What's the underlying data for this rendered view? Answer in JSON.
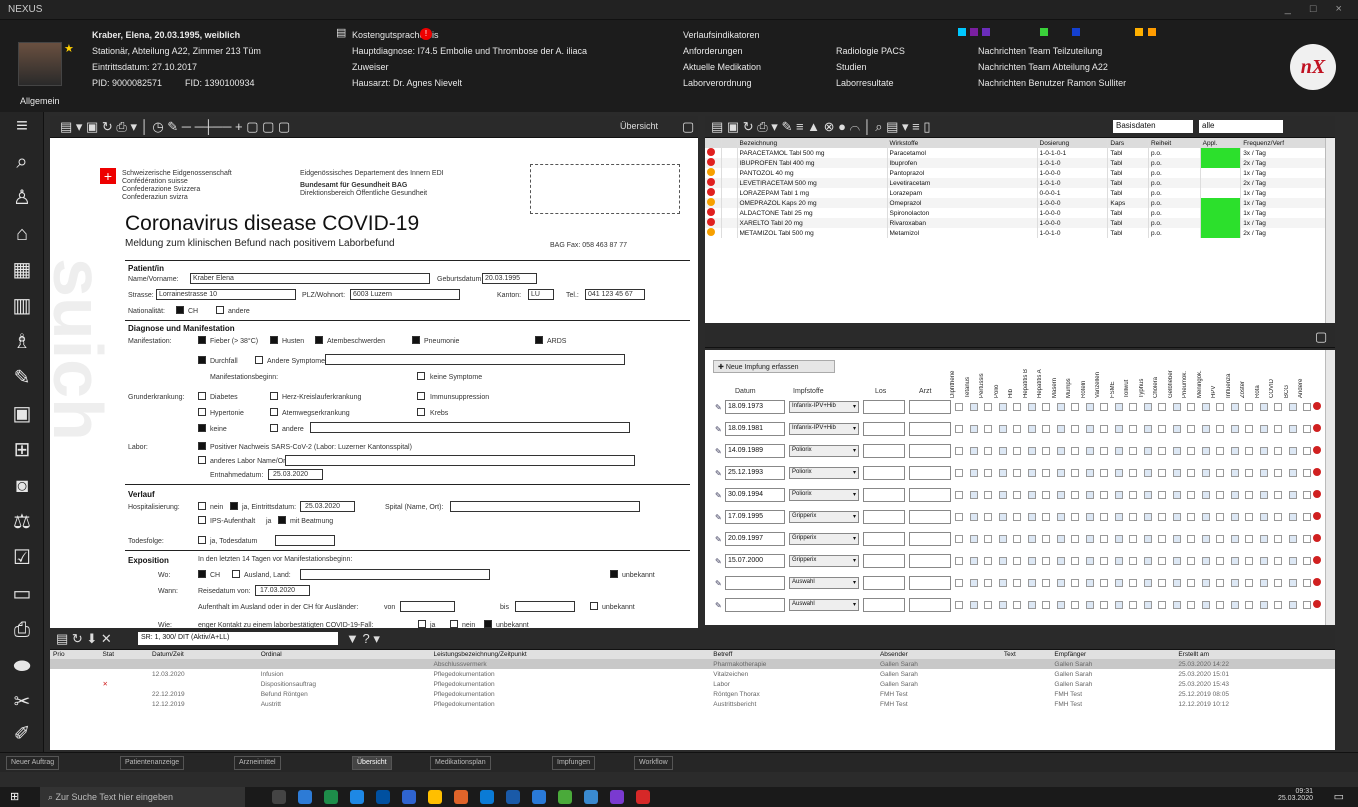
{
  "window": {
    "title": "NEXUS",
    "controls": "_ □ ×"
  },
  "header": {
    "patient_name": "Kraber, Elena, 20.03.1995, weiblich",
    "ward": "Stationär, Abteilung A22, Zimmer 213 Tüm",
    "entry_date": "Eintrittsdatum: 27.10.2017",
    "pid": "PID: 9000082571",
    "fid": "FID: 1390100934",
    "general": "Allgemein",
    "kostengut": "Kostengutsprache bis",
    "diagnosis": "Hauptdiagnose: I74.5 Embolie und Thrombose der A. iliaca",
    "zuweiser": "Zuweiser",
    "hausarzt": "Hausarzt: Dr. Agnes Nievelt",
    "links1": [
      "Verlaufsindikatoren",
      "Anforderungen",
      "Aktuelle Medikation",
      "Laborverordnung"
    ],
    "links2": [
      "Radiologie PACS",
      "Studien",
      "Laborresultate"
    ],
    "news": [
      "Nachrichten Team Teilzuteilung",
      "Nachrichten Team Abteilung A22",
      "Nachrichten Benutzer Ramon Sulliter"
    ],
    "logo": "nX"
  },
  "sidebar_icons": [
    "menu-icon",
    "search-icon",
    "patient-icon",
    "home-icon",
    "calendar-icon",
    "chart-icon",
    "user-tree-icon",
    "edit-icon",
    "image-icon",
    "bed-icon",
    "monitor-icon",
    "scale-icon",
    "clipboard-icon",
    "screen-icon",
    "print-icon",
    "pills-icon",
    "scissors-icon",
    "pen-icon"
  ],
  "doc_toolbar": {
    "view_label": "Übersicht"
  },
  "document": {
    "org_lines": [
      "Schweizerische Eidgenossenschaft",
      "Confédération suisse",
      "Confederazione Svizzera",
      "Confederaziun svizra"
    ],
    "dept_lines": [
      "Eidgenössisches Departement des Innern EDI",
      "Bundesamt für Gesundheit BAG",
      "Direktionsbereich Öffentliche Gesundheit"
    ],
    "title": "Coronavirus disease COVID-19",
    "subtitle": "Meldung zum klinischen Befund nach positivem Laborbefund",
    "fax_note": "BAG Fax: 058 463 87 77",
    "patient_h": "Patient/in",
    "name_label": "Name/Vorname:",
    "name_value": "Kraber Elena",
    "birth_label": "Geburtsdatum:",
    "birth_value": "20.03.1995",
    "street_label": "Strasse:",
    "street_value": "Lorrainestrasse 10",
    "plz_label": "PLZ/Wohnort:",
    "plz_value": "6003 Luzern",
    "canton_label": "Kanton:",
    "canton_value": "LU",
    "tel_label": "Tel.:",
    "tel_value": "041 123 45 67",
    "nation_label": "Nationalität:",
    "nation_ch": "CH",
    "nation_other": "andere",
    "diag_h": "Diagnose und Manifestation",
    "manif_label": "Manifestation:",
    "fever": "Fieber (> 38°C)",
    "cough": "Husten",
    "breath": "Atembeschwerden",
    "pneumonia": "Pneumonie",
    "ards": "ARDS",
    "diarrhea": "Durchfall",
    "other_sym": "Andere Symptome:",
    "onset": "Manifestationsbeginn:",
    "nosym": "keine Symptome",
    "comorb_label": "Grunderkrankung:",
    "diabetes": "Diabetes",
    "cardio": "Herz-Kreislauferkrankung",
    "immuno": "Immunsuppression",
    "hypert": "Hypertonie",
    "resp": "Atemwegserkrankung",
    "cancer": "Krebs",
    "none": "keine",
    "other": "andere",
    "lab_label": "Labor:",
    "lab_pos": "Positiver Nachweis SARS-CoV-2 (Labor: Luzerner Kantonsspital)",
    "lab_other": "anderes Labor Name/Ort:",
    "lab_date_label": "Entnahmedatum:",
    "lab_date": "25.03.2020",
    "course_h": "Verlauf",
    "hosp_label": "Hospitalisierung:",
    "hosp_no": "nein",
    "hosp_yes": "ja, Eintrittsdatum:",
    "hosp_date": "25.03.2020",
    "spital": "Spital (Name, Ort):",
    "ips": "IPS-Aufenthalt",
    "ips_yes": "ja",
    "ventil": "mit Beatmung",
    "death_label": "Todesfolge:",
    "death_yes": "ja, Todesdatum",
    "expo_h": "Exposition",
    "expo_q": "In den letzten 14 Tagen vor Manifestationsbeginn:",
    "where": "Wo:",
    "ch": "CH",
    "abroad": "Ausland, Land:",
    "unknown": "unbekannt",
    "when": "Wann:",
    "travel_label": "Reisedatum von:",
    "travel_date": "17.03.2020",
    "stay": "Aufenthalt im Ausland oder in der CH für Ausländer:",
    "stay_von": "von",
    "stay_bis": "bis",
    "how": "Wie:",
    "contact": "enger Kontakt zu einem laborbestätigten COVID-19-Fall:",
    "contact_yes": "ja",
    "contact_no": "nein",
    "contact_unk": "unbekannt"
  },
  "med_toolbar": {
    "filter1": "Basisdaten",
    "filter2": "alle"
  },
  "medication": {
    "columns": [
      "",
      "",
      "Bezeichnung",
      "Wirkstoffe",
      "Dosierung",
      "Dars",
      "Reiheit",
      "Appl.",
      "Frequenz/Verf"
    ],
    "rows": [
      {
        "name": "PARACETAMOL Tabl 500 mg",
        "drug": "Paracetamol",
        "dose": "1-0-1-0-1",
        "route": "Tabl",
        "mark": "p.o.",
        "freq": "3x / Tag",
        "green": true
      },
      {
        "name": "IBUPROFEN Tabl 400 mg",
        "drug": "Ibuprofen",
        "dose": "1-0-1-0",
        "route": "Tabl",
        "mark": "p.o.",
        "freq": "2x / Tag",
        "green": true
      },
      {
        "name": "PANTOZOL 40 mg",
        "drug": "Pantoprazol",
        "dose": "1-0-0-0",
        "route": "Tabl",
        "mark": "p.o.",
        "freq": "1x / Tag",
        "green": false
      },
      {
        "name": "LEVETIRACETAM 500 mg",
        "drug": "Levetiracetam",
        "dose": "1-0-1-0",
        "route": "Tabl",
        "mark": "p.o.",
        "freq": "2x / Tag",
        "green": false
      },
      {
        "name": "LORAZEPAM Tabl 1 mg",
        "drug": "Lorazepam",
        "dose": "0-0-0-1",
        "route": "Tabl",
        "mark": "p.o.",
        "freq": "1x / Tag",
        "green": false
      },
      {
        "name": "OMEPRAZOL Kaps 20 mg",
        "drug": "Omeprazol",
        "dose": "1-0-0-0",
        "route": "Kaps",
        "mark": "p.o.",
        "freq": "1x / Tag",
        "green": true
      },
      {
        "name": "ALDACTONE Tabl 25 mg",
        "drug": "Spironolacton",
        "dose": "1-0-0-0",
        "route": "Tabl",
        "mark": "p.o.",
        "freq": "1x / Tag",
        "green": true
      },
      {
        "name": "XARELTO Tabl 20 mg",
        "drug": "Rivaroxaban",
        "dose": "1-0-0-0",
        "route": "Tabl",
        "mark": "p.o.",
        "freq": "1x / Tag",
        "green": true
      },
      {
        "name": "METAMIZOL Tabl 500 mg",
        "drug": "Metamizol",
        "dose": "1-0-1-0",
        "route": "Tabl",
        "mark": "p.o.",
        "freq": "2x / Tag",
        "green": true
      }
    ]
  },
  "vaccination": {
    "new_button": "Neue Impfung erfassen",
    "headers": [
      "Datum",
      "Impfstoffe",
      "Los",
      "Arzt"
    ],
    "rows": [
      {
        "date": "18.09.1973",
        "vaccine": "Infanrix-IPV+Hib"
      },
      {
        "date": "18.09.1981",
        "vaccine": "Infanrix-IPV+Hib"
      },
      {
        "date": "14.09.1989",
        "vaccine": "Poliorix"
      },
      {
        "date": "25.12.1993",
        "vaccine": "Poliorix"
      },
      {
        "date": "30.09.1994",
        "vaccine": "Poliorix"
      },
      {
        "date": "17.09.1995",
        "vaccine": "Gripperix"
      },
      {
        "date": "20.09.1997",
        "vaccine": "Gripperix"
      },
      {
        "date": "15.07.2000",
        "vaccine": "Gripperix"
      },
      {
        "date": "",
        "vaccine": "Auswahl"
      },
      {
        "date": "",
        "vaccine": "Auswahl"
      }
    ],
    "col_headers": [
      "Diphtherie",
      "Tetanus",
      "Pertussis",
      "Polio",
      "Hib",
      "Hepatitis B",
      "Hepatitis A",
      "Masern",
      "Mumps",
      "Röteln",
      "Varizellen",
      "FSME",
      "Tollwut",
      "Typhus",
      "Cholera",
      "Gelbfieber",
      "Pneumok.",
      "Meningok.",
      "HPV",
      "Influenza",
      "Zoster",
      "Rota",
      "COVID",
      "BCG",
      "Andere"
    ]
  },
  "bottom_toolbar": {
    "filter": "SR: 1, 300/ DIT (Aktiv/A+LL)"
  },
  "bottom": {
    "columns": [
      "Prio",
      "Stat",
      "Datum/Zeit",
      "Ordinal",
      "Leistungsbezeichnung/Zeitpunkt",
      "Betreff",
      "Absender",
      "Text",
      "Empfänger",
      "Erstellt am"
    ],
    "rows": [
      [
        "",
        "",
        "",
        "",
        "Abschlussvermerk",
        "Pharmakotherapie",
        "Gallen Sarah",
        "",
        "Gallen Sarah",
        "25.03.2020 14:22"
      ],
      [
        "",
        "",
        "12.03.2020",
        "Infusion",
        "Pflegedokumentation",
        "Vitalzeichen",
        "Gallen Sarah",
        "",
        "Gallen Sarah",
        "25.03.2020 15:01"
      ],
      [
        "",
        "✕",
        "",
        "Dispositionsauftrag",
        "Pflegedokumentation",
        "Labor",
        "Gallen Sarah",
        "",
        "Gallen Sarah",
        "25.03.2020 15:43"
      ],
      [
        "",
        "",
        "22.12.2019",
        "Befund Röntgen",
        "Pflegedokumentation",
        "Röntgen Thorax",
        "FMH Test",
        "",
        "FMH Test",
        "25.12.2019 08:05"
      ],
      [
        "",
        "",
        "12.12.2019",
        "Austritt",
        "Pflegedokumentation",
        "Austrittsbericht",
        "FMH Test",
        "",
        "FMH Test",
        "12.12.2019 10:12"
      ]
    ]
  },
  "tabs": [
    "Neuer Auftrag",
    "Patientenanzeige",
    "Arzneimittel",
    "Übersicht",
    "Medikationsplan",
    "Impfungen",
    "Workflow"
  ],
  "tab_active": "Übersicht",
  "taskbar": {
    "search": "Zur Suche Text hier eingeben",
    "time": "09:31",
    "date": "25.03.2020"
  }
}
